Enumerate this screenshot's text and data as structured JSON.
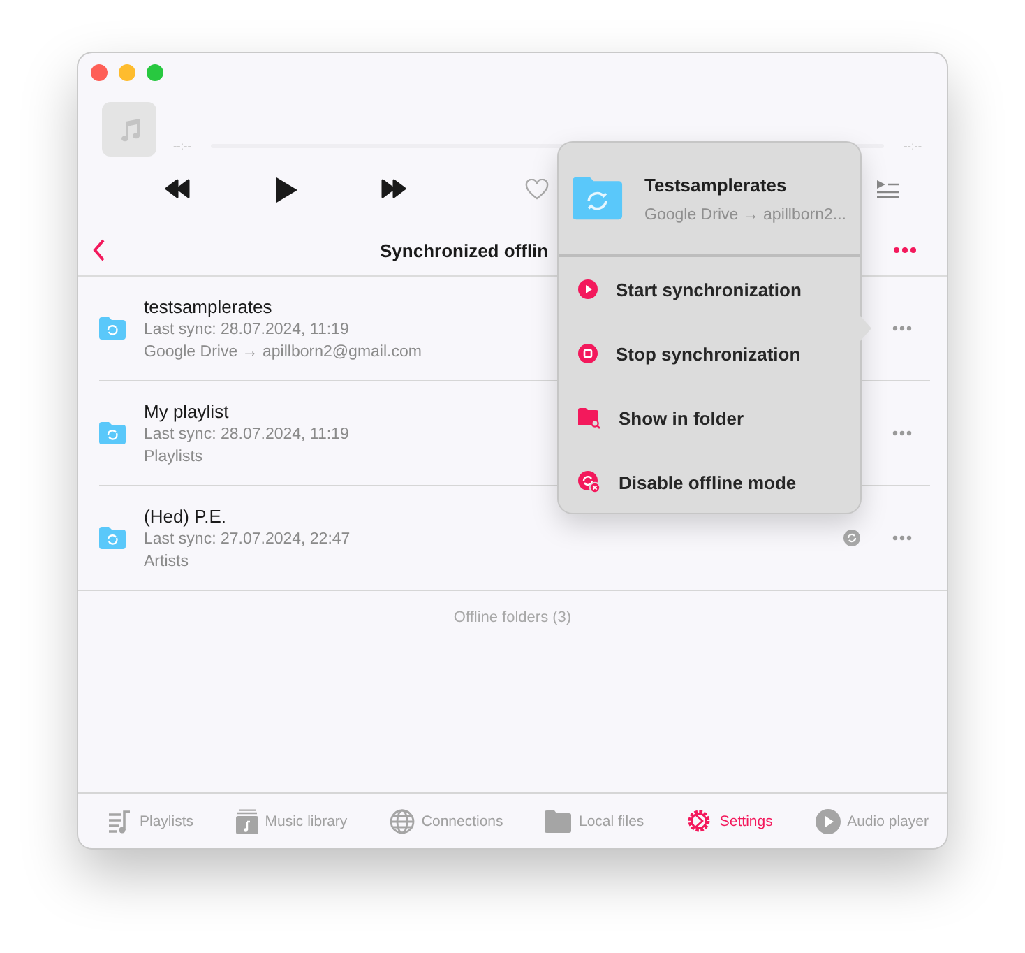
{
  "player": {
    "time_elapsed": "--:--",
    "time_remaining": "--:--"
  },
  "nav": {
    "title": "Synchronized offlin"
  },
  "folders": [
    {
      "name": "testsamplerates",
      "last_sync": "Last sync: 28.07.2024, 11:19",
      "source": "Google Drive → apillborn2@gmail.com",
      "status_icon": false
    },
    {
      "name": "My playlist",
      "last_sync": "Last sync: 28.07.2024, 11:19",
      "source": "Playlists",
      "status_icon": false
    },
    {
      "name": "(Hed) P.E.",
      "last_sync": "Last sync: 27.07.2024, 22:47",
      "source": "Artists",
      "status_icon": true
    }
  ],
  "footer_note": "Offline folders (3)",
  "popover": {
    "title": "Testsamplerates",
    "subtitle": "Google Drive → apillborn2...",
    "items": [
      {
        "kind": "play",
        "label": "Start synchronization"
      },
      {
        "kind": "stop",
        "label": "Stop synchronization"
      },
      {
        "kind": "folder",
        "label": "Show in folder"
      },
      {
        "kind": "disable",
        "label": "Disable offline mode"
      }
    ]
  },
  "tabs": [
    {
      "kind": "playlists",
      "label": "Playlists",
      "selected": false
    },
    {
      "kind": "library",
      "label": "Music library",
      "selected": false
    },
    {
      "kind": "connections",
      "label": "Connections",
      "selected": false
    },
    {
      "kind": "files",
      "label": "Local files",
      "selected": false
    },
    {
      "kind": "settings",
      "label": "Settings",
      "selected": true
    },
    {
      "kind": "player",
      "label": "Audio player",
      "selected": false
    }
  ]
}
